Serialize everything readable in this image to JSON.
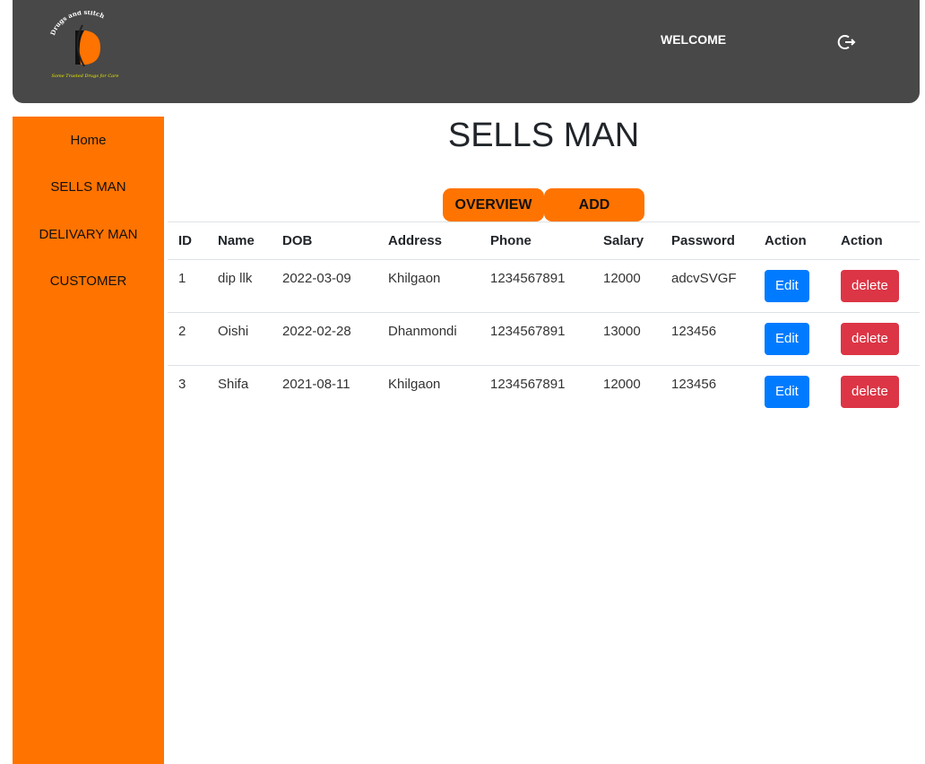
{
  "header": {
    "logo_text_top": "Drugs and stitch",
    "logo_text_bottom": "Some Trusted Drugs for Care",
    "welcome": "WELCOME",
    "logout_icon": "logout-icon"
  },
  "sidebar": {
    "items": [
      {
        "label": "Home"
      },
      {
        "label": "SELLS MAN"
      },
      {
        "label": "DELIVARY MAN"
      },
      {
        "label": "CUSTOMER"
      }
    ]
  },
  "main": {
    "title": "SELLS MAN",
    "tabs": [
      {
        "label": "OVERVIEW"
      },
      {
        "label": "ADD"
      }
    ],
    "table": {
      "headers": [
        "ID",
        "Name",
        "DOB",
        "Address",
        "Phone",
        "Salary",
        "Password",
        "Action",
        "Action"
      ],
      "rows": [
        {
          "id": "1",
          "name": "dip llk",
          "dob": "2022-03-09",
          "address": "Khilgaon",
          "phone": "1234567891",
          "salary": "12000",
          "password": "adcvSVGF",
          "edit": "Edit",
          "delete": "delete"
        },
        {
          "id": "2",
          "name": "Oishi",
          "dob": "2022-02-28",
          "address": "Dhanmondi",
          "phone": "1234567891",
          "salary": "13000",
          "password": "123456",
          "edit": "Edit",
          "delete": "delete"
        },
        {
          "id": "3",
          "name": "Shifa",
          "dob": "2021-08-11",
          "address": "Khilgaon",
          "phone": "1234567891",
          "salary": "12000",
          "password": "123456",
          "edit": "Edit",
          "delete": "delete"
        }
      ]
    }
  },
  "colors": {
    "accent": "#ff7300",
    "header_bg": "#484848",
    "edit": "#007bff",
    "delete": "#dc3545"
  }
}
